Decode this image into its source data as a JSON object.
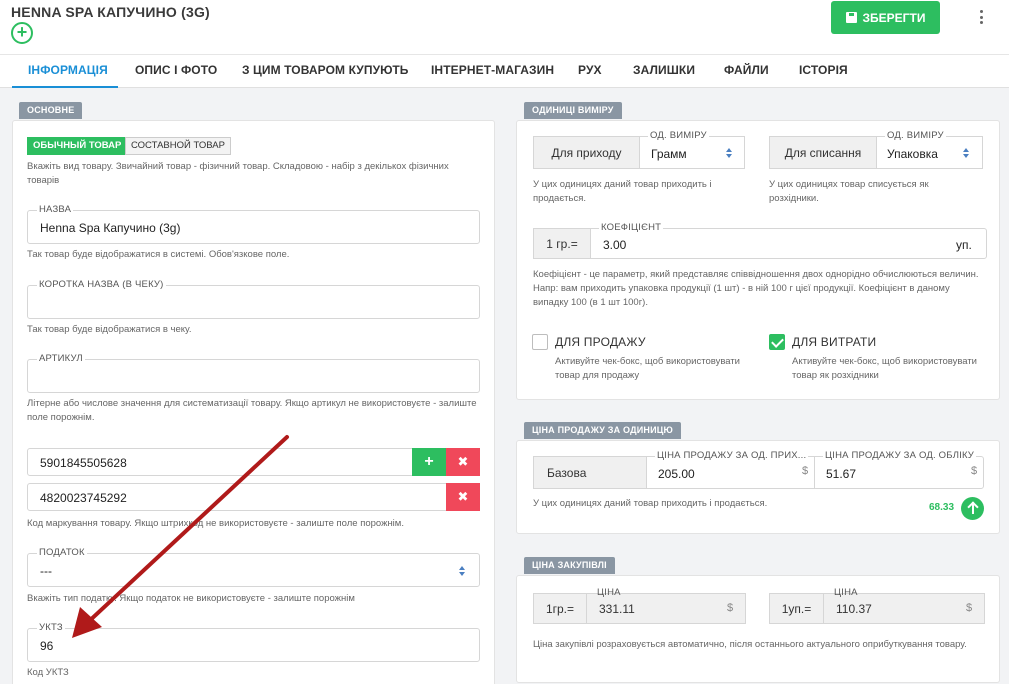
{
  "header": {
    "title": "HENNA SPA КАПУЧИНО (3G)",
    "save_label": "ЗБЕРЕГТИ"
  },
  "tabs": [
    {
      "label": "ІНФОРМАЦІЯ",
      "active": true
    },
    {
      "label": "ОПИС І ФОТО"
    },
    {
      "label": "З ЦИМ ТОВАРОМ КУПУЮТЬ"
    },
    {
      "label": "ІНТЕРНЕТ-МАГАЗИН"
    },
    {
      "label": "РУХ"
    },
    {
      "label": "ЗАЛИШКИ"
    },
    {
      "label": "ФАЙЛИ"
    },
    {
      "label": "ІСТОРІЯ"
    }
  ],
  "basic": {
    "section": "ОСНОВНЕ",
    "type_ordinary": "ОБЫЧНЫЙ ТОВАР",
    "type_composite": "СОСТАВНОЙ ТОВАР",
    "type_hint": "Вкажіть вид товару. Звичайний товар - фізичний товар. Складовою - набір з декількох фізичних товарів",
    "name_label": "НАЗВА",
    "name_value": "Henna Spa Капучино (3g)",
    "name_hint": "Так товар буде відображатися в системі. Обов'язкове поле.",
    "short_label": "КОРОТКА НАЗВА (В ЧЕКУ)",
    "short_value": "",
    "short_hint": "Так товар буде відображатися в чеку.",
    "article_label": "АРТИКУЛ",
    "article_value": "",
    "article_hint": "Літерне або числове значення для систематизації товару. Якщо артикул не використовуєте - залиште поле порожнім.",
    "barcodes": [
      "5901845505628",
      "4820023745292"
    ],
    "barcode_hint": "Код маркування товару. Якщо штрихкод не використовуєте - залиште поле порожнім.",
    "tax_label": "ПОДАТОК",
    "tax_value": "---",
    "tax_hint": "Вкажіть тип податку. Якщо податок не використовуєте - залиште порожнім",
    "uktz_label": "УКТЗ",
    "uktz_value": "96",
    "uktz_hint": "Код УКТЗ"
  },
  "units": {
    "section": "ОДИНИЦІ ВИМІРУ",
    "incoming_label": "Для приходу",
    "incoming_unit_label": "ОД. ВИМІРУ",
    "incoming_unit_value": "Грамм",
    "incoming_hint": "У цих одиницях даний товар приходить і продається.",
    "writeoff_label": "Для списання",
    "writeoff_unit_label": "ОД. ВИМІРУ",
    "writeoff_unit_value": "Упаковка",
    "writeoff_hint": "У цих одиницях товар списується як розхідники.",
    "coef_prefix": "1 гр.=",
    "coef_label": "КОЕФІЦІЄНТ",
    "coef_value": "3.00",
    "coef_suffix": "уп.",
    "coef_hint": "Коефіцієнт - це параметр, який представляє співвідношення двох однорідно обчислюються величин. Напр: вам приходить упаковка продукції (1 шт) - в ній 100 г цієї продукції. Коефіцієнт в даному випадку 100 (в 1 шт 100г).",
    "for_sale_label": "ДЛЯ ПРОДАЖУ",
    "for_sale_checked": false,
    "for_sale_hint": "Активуйте чек-бокс, щоб використовувати товар для продажу",
    "for_expense_label": "ДЛЯ ВИТРАТИ",
    "for_expense_checked": true,
    "for_expense_hint": "Активуйте чек-бокс, щоб використовувати товар як розхідники"
  },
  "sale_price": {
    "section": "ЦІНА ПРОДАЖУ ЗА ОДИНИЦЮ",
    "base_label": "Базова",
    "incoming_label": "ЦІНА ПРОДАЖУ ЗА ОД. ПРИХ...",
    "incoming_value": "205.00",
    "accounting_label": "ЦІНА ПРОДАЖУ ЗА ОД. ОБЛІКУ",
    "accounting_value": "51.67",
    "currency": "$",
    "hint": "У цих одиницях даний товар приходить і продається.",
    "markup_value": "68.33"
  },
  "purchase_price": {
    "section": "ЦІНА ЗАКУПІВЛІ",
    "left_prefix": "1гр.=",
    "left_label": "ЦІНА",
    "left_value": "331.11",
    "right_prefix": "1уп.=",
    "right_label": "ЦІНА",
    "right_value": "110.37",
    "currency": "$",
    "hint": "Ціна закупівлі розраховується автоматично, після останнього актуального оприбуткування товару."
  },
  "colors": {
    "accent": "#1a8fd6",
    "success": "#2dbe60",
    "danger": "#f0485a",
    "tag": "#8a96a3",
    "arrow": "#b01a1a"
  }
}
